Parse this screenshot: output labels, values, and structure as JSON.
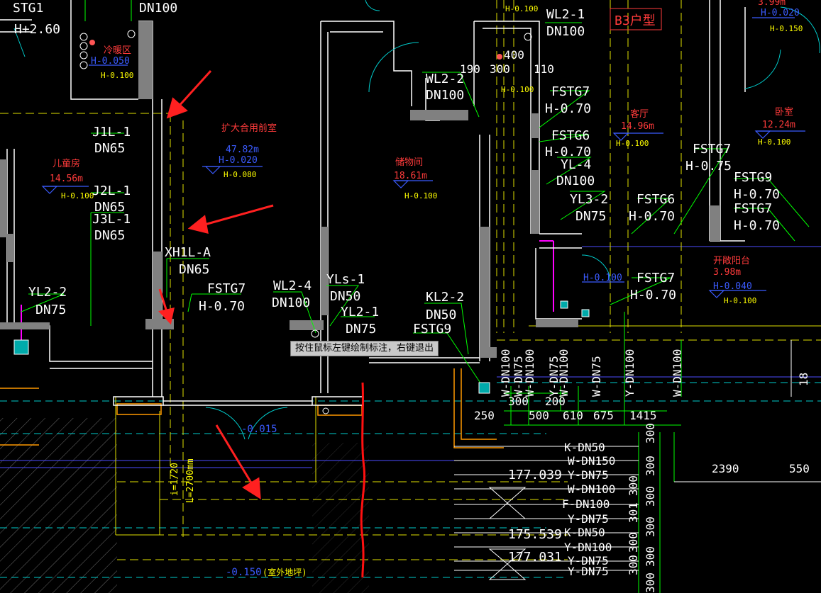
{
  "colors": {
    "wall": "#ffffff",
    "wall_fill": "#808080",
    "annotation_white": "#ffffff",
    "leader_green": "#00c800",
    "elevation_yellow": "#ffff00",
    "area_blue": "#3b5bff",
    "room_red": "#ff3b3b",
    "pipe_cyan": "#00cccc",
    "pipe_magenta": "#ff00ff",
    "dim_green": "#00ff00",
    "dash_yellow": "#e0e000",
    "arrow_red": "#ff2020"
  },
  "tooltip": "按住鼠标左键绘制标注，右键退出",
  "labels": {
    "stg1": "STG1",
    "h_2_60": "H+2.60",
    "dn100_top": "DN100",
    "h_0_050": "H-0.050",
    "h_0_100_a": "H-0.100",
    "j1l_1": "J1L-1",
    "dn65_a": "DN65",
    "room_child": "儿童房",
    "area_child": "14.56m",
    "h_0_100_b": "H-0.100",
    "j2l_1": "J2L-1",
    "dn65_b": "DN65",
    "j3l_1": "J3L-1",
    "dn65_c": "DN65",
    "yl2_2": "YL2-2",
    "dn75_a": "DN75",
    "fire_room": "扩大合用前室",
    "area_fire": "47.82m",
    "h_0_020_a": "H-0.020",
    "h_0_080": "H-0.080",
    "xh1l_a": "XH1L-A",
    "dn65_d": "DN65",
    "fstg7_a": "FSTG7",
    "h_0_70_a": "H-0.70",
    "wl2_4": "WL2-4",
    "dn100_a": "DN100",
    "yls_1": "YLs-1",
    "dn50_a": "DN50",
    "yl2_1": "YL2-1",
    "dn75_b": "DN75",
    "storage": "储物间",
    "area_storage": "18.61m",
    "h_0_100_c": "H-0.100",
    "wl2_2": "WL2-2",
    "dn100_b": "DN100",
    "kl2_2": "KL2-2",
    "dn50_b": "DN50",
    "fstg9_a": "FSTG9",
    "h_0_100_top": "H-0.100",
    "wl2_1": "WL2-1",
    "dn100_c": "DN100",
    "b3_type": "B3户型",
    "dim_190": "190",
    "dim_300": "300",
    "dim_400": "400",
    "dim_110": "110",
    "h_0_100_d": "H-0.100",
    "fstg7_b": "FSTG7",
    "h_0_70_b": "H-0.70",
    "fstg6_a": "FSTG6",
    "h_0_70_c": "H-0.70",
    "yl_4": "YL-4",
    "dn100_d": "DN100",
    "yl3_2": "YL3-2",
    "dn75_c": "DN75",
    "fstg6_b": "FSTG6",
    "h_0_70_d": "H-0.70",
    "living": "客厅",
    "area_living": "14.96m",
    "h_0_100_e": "H-0.100",
    "bedroom": "卧室",
    "area_bedroom": "12.24m",
    "h_0_100_f": "H-0.100",
    "fstg7_c": "FSTG7",
    "h_0_75": "H-0.75",
    "fstg9_b": "FSTG9",
    "h_0_70_e": "H-0.70",
    "fstg7_d": "FSTG7",
    "h_0_70_f": "H-0.70",
    "h_0_100_g": "H-0.100",
    "fstg7_e": "FSTG7",
    "h_0_70_g": "H-0.70",
    "balcony": "开敞阳台",
    "area_balcony": "3.98m",
    "h_0_040": "H-0.040",
    "h_0_100_h": "H-0.100",
    "h_0_020_b": "H-0.020",
    "h_0_150_a": "H-0.150",
    "top_val": "3.99m",
    "dim_250": "250",
    "dim_300b": "300",
    "dim_200": "200",
    "dim_500": "500",
    "dim_610": "610",
    "dim_675": "675",
    "dim_1415": "1415",
    "dim_2390": "2390",
    "dim_550": "550",
    "v_w_dn100_1": "W-DN100",
    "v_w_dn75_1": "W-DN75",
    "v_w_dn100_2": "W-DN100",
    "v_y_dn75_1": "Y-DN75",
    "v_w_dn100_3": "W-DN100",
    "v_w_dn75_2": "W-DN75",
    "v_y_dn100": "Y-DN100",
    "v_w_dn100_4": "W-DN100",
    "v_18": "18",
    "p_k_dn50_1": "K-DN50",
    "p_w_dn150": "W-DN150",
    "p_y_dn75_1": "Y-DN75",
    "elev_1": "177.039",
    "p_w_dn100": "W-DN100",
    "p_f_dn100": "F-DN100",
    "p_y_dn75_2": "Y-DN75",
    "elev_2": "175.539",
    "p_k_dn50_2": "K-DN50",
    "p_y_dn100": "Y-DN100",
    "elev_3": "177.031",
    "p_y_dn75_3": "Y-DN75",
    "p_y_dn75_4": "Y-DN75",
    "col_300_1": "300",
    "col_300_2": "300",
    "col_300_3": "300",
    "col_300_4": "300",
    "col_301": "301",
    "col_300_5": "300",
    "col_300_6": "300",
    "col_300_7": "300",
    "col_300_8": "300",
    "col_300_9": "300",
    "slope_1": "i=1/20",
    "slope_len": "L=2700mm",
    "door_elev": "-0.015",
    "bottom_elev": "-0.150",
    "outdoor": "(室外地坪)"
  }
}
